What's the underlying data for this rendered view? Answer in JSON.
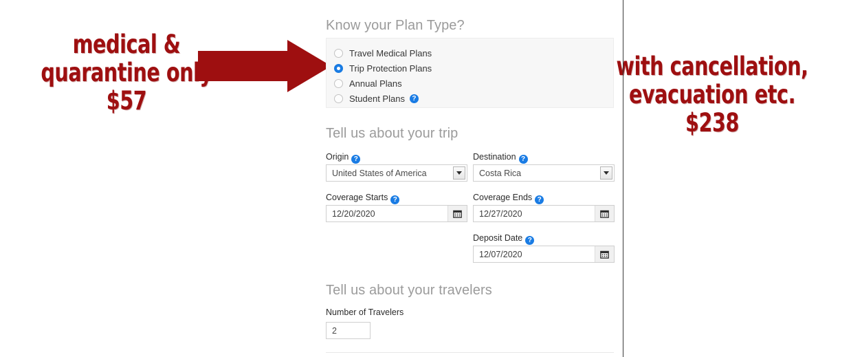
{
  "annotations": {
    "left": {
      "line1": "medical &",
      "line2": "quarantine only",
      "line3": "$57",
      "arrow_name": "right-pointing-arrow",
      "color": "#9e0f10"
    },
    "right": {
      "line1": "with cancellation,",
      "line2": "evacuation etc.",
      "line3": "$238",
      "arrow_name": "left-pointing-arrow",
      "color": "#9e0f10"
    }
  },
  "form": {
    "plan_type": {
      "heading": "Know your Plan Type?",
      "options": [
        {
          "label": "Travel Medical Plans",
          "selected": false,
          "help": false
        },
        {
          "label": "Trip Protection Plans",
          "selected": true,
          "help": false
        },
        {
          "label": "Annual Plans",
          "selected": false,
          "help": false
        },
        {
          "label": "Student Plans",
          "selected": false,
          "help": true
        }
      ],
      "help_glyph": "?"
    },
    "trip": {
      "heading": "Tell us about your trip",
      "origin": {
        "label": "Origin",
        "value": "United States of America",
        "help": "?"
      },
      "destination": {
        "label": "Destination",
        "value": "Costa Rica",
        "help": "?"
      },
      "coverage_starts": {
        "label": "Coverage Starts",
        "value": "12/20/2020",
        "help": "?",
        "icon": "calendar-icon"
      },
      "coverage_ends": {
        "label": "Coverage Ends",
        "value": "12/27/2020",
        "help": "?",
        "icon": "calendar-icon"
      },
      "deposit_date": {
        "label": "Deposit Date",
        "value": "12/07/2020",
        "help": "?",
        "icon": "calendar-icon"
      }
    },
    "travelers": {
      "heading": "Tell us about your travelers",
      "number_label": "Number of Travelers",
      "number_value": "2"
    }
  },
  "colors": {
    "accent_blue": "#1a7ce4",
    "annotation_red": "#9e0f10",
    "heading_gray": "#9b9b9b",
    "panel_bg": "#f7f7f7"
  }
}
